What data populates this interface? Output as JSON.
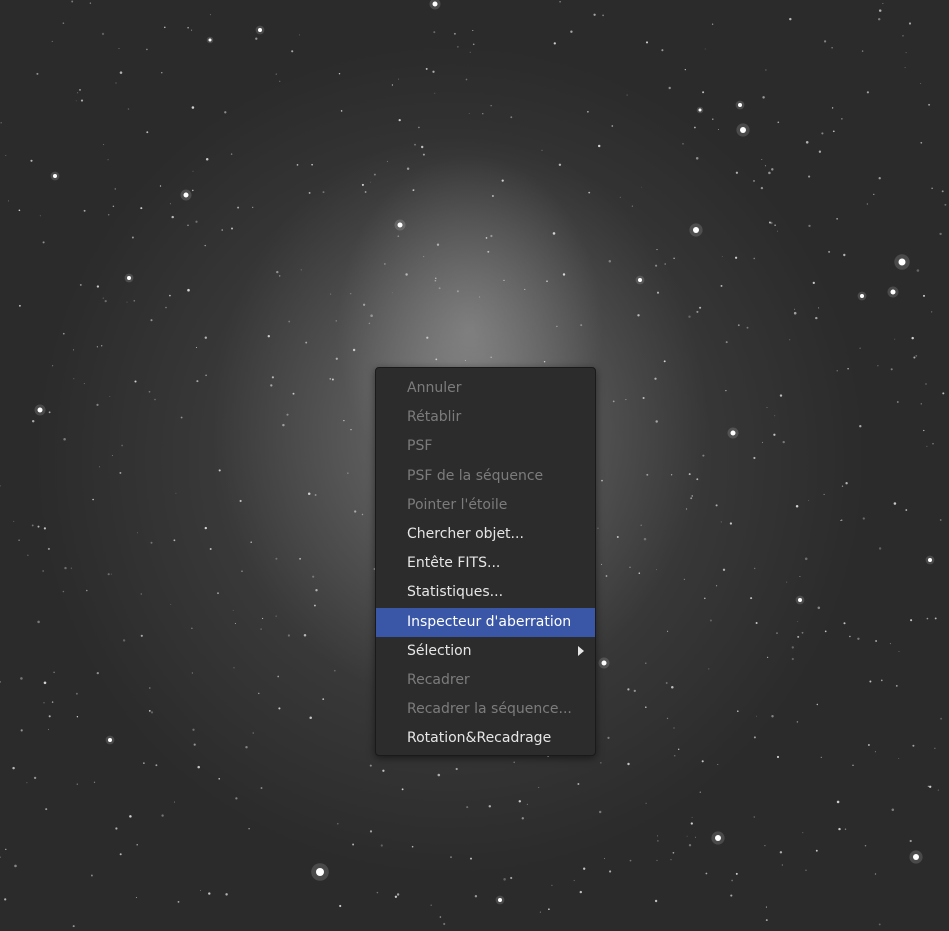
{
  "context_menu": {
    "items": [
      {
        "label": "Annuler",
        "enabled": false
      },
      {
        "label": "Rétablir",
        "enabled": false
      },
      {
        "label": "PSF",
        "enabled": false
      },
      {
        "label": "PSF de la séquence",
        "enabled": false
      },
      {
        "label": "Pointer l'étoile",
        "enabled": false
      },
      {
        "label": "Chercher objet...",
        "enabled": true
      },
      {
        "label": "Entête FITS...",
        "enabled": true
      },
      {
        "label": "Statistiques...",
        "enabled": true
      },
      {
        "label": "Inspecteur d'aberration",
        "enabled": true,
        "highlighted": true
      },
      {
        "label": "Sélection",
        "enabled": true,
        "submenu": true
      },
      {
        "label": "Recadrer",
        "enabled": false
      },
      {
        "label": "Recadrer la séquence...",
        "enabled": false
      },
      {
        "label": "Rotation&Recadrage",
        "enabled": true
      }
    ],
    "colors": {
      "background": "#2c2c2c",
      "highlight": "#3a56a6",
      "text": "#e6e6e6",
      "disabled_text": "#7c7c7c"
    }
  }
}
